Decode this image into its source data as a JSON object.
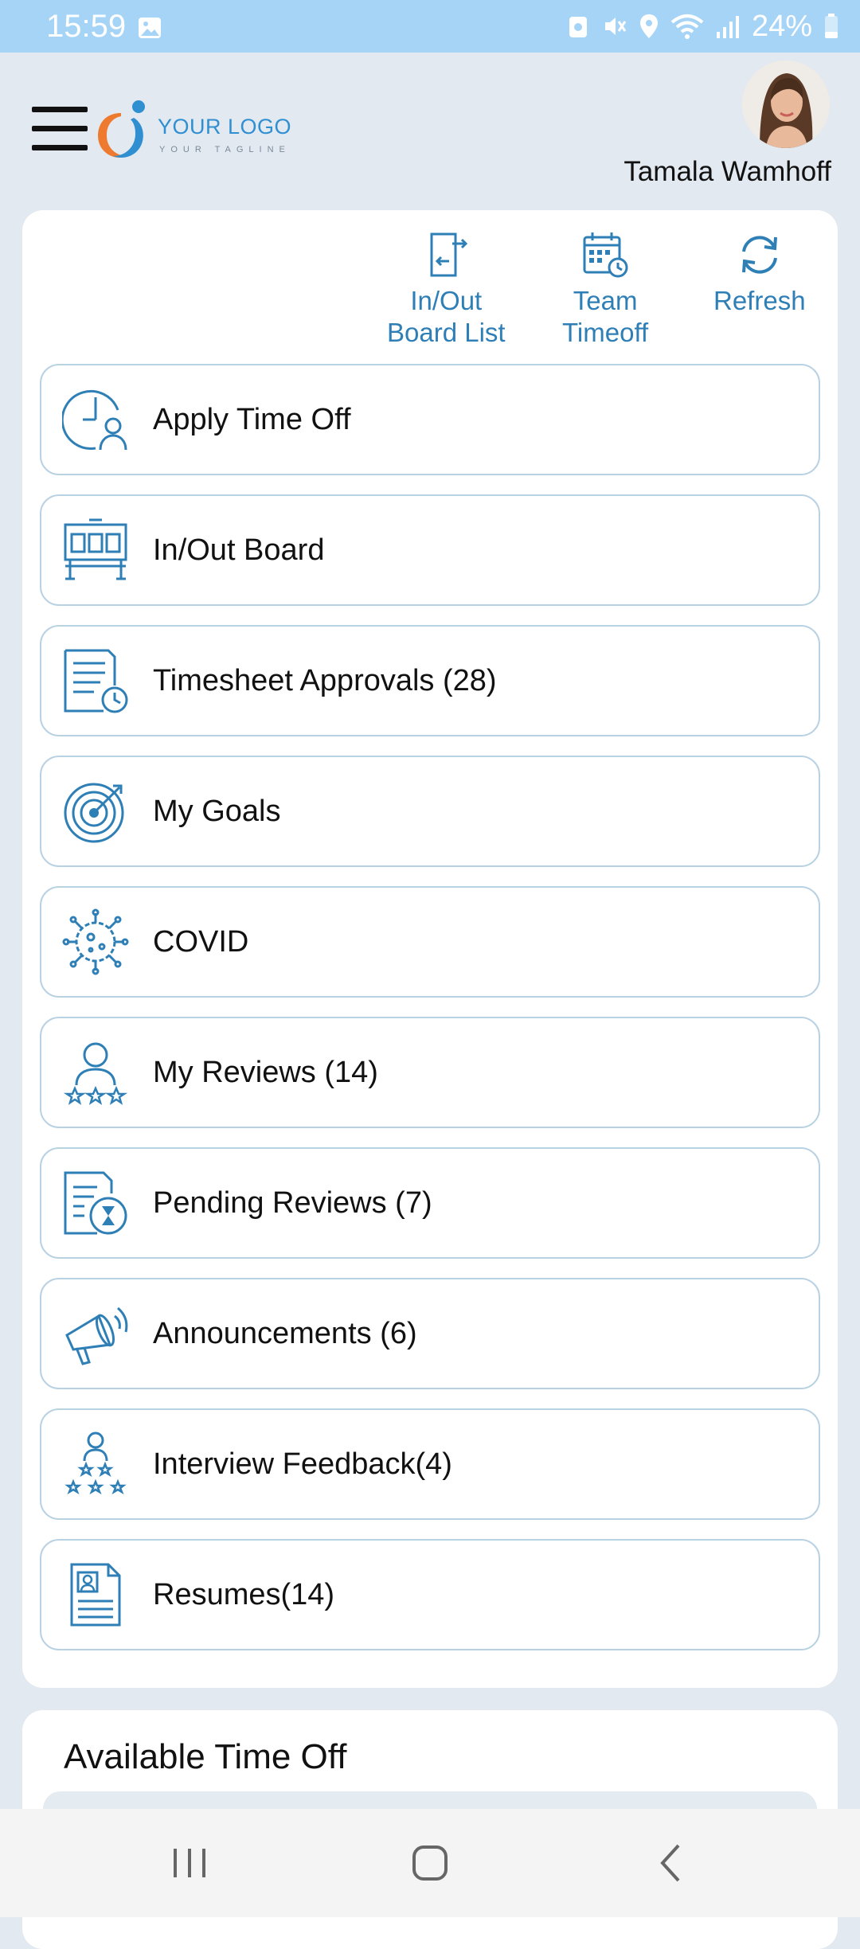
{
  "status_bar": {
    "time": "15:59",
    "battery": "24%"
  },
  "header": {
    "logo_text": "YOUR LOGO",
    "logo_tagline": "YOUR TAGLINE",
    "user_name": "Tamala Wamhoff"
  },
  "quick_actions": [
    {
      "label": "In/Out\nBoard List",
      "icon": "door-arrows-icon"
    },
    {
      "label": "Team\nTimeoff",
      "icon": "calendar-clock-icon"
    },
    {
      "label": "Refresh",
      "icon": "refresh-icon"
    }
  ],
  "menu": [
    {
      "label": "Apply Time Off",
      "icon": "clock-person-icon"
    },
    {
      "label": "In/Out Board",
      "icon": "board-icon"
    },
    {
      "label": "Timesheet Approvals (28)",
      "icon": "timesheet-clock-icon"
    },
    {
      "label": "My Goals",
      "icon": "target-icon"
    },
    {
      "label": "COVID",
      "icon": "virus-icon"
    },
    {
      "label": "My Reviews (14)",
      "icon": "person-stars-icon"
    },
    {
      "label": " Pending Reviews (7)",
      "icon": "document-hourglass-icon"
    },
    {
      "label": "Announcements (6)",
      "icon": "megaphone-icon"
    },
    {
      "label": "Interview Feedback(4)",
      "icon": "person-star-tree-icon"
    },
    {
      "label": "Resumes(14)",
      "icon": "resume-icon"
    }
  ],
  "available_time_off": {
    "title": "Available Time Off"
  },
  "colors": {
    "accent": "#2f7fb7",
    "status_bar": "#a6d4f7",
    "page_bg": "#e2e9f0",
    "item_border": "#b9d2e3"
  }
}
